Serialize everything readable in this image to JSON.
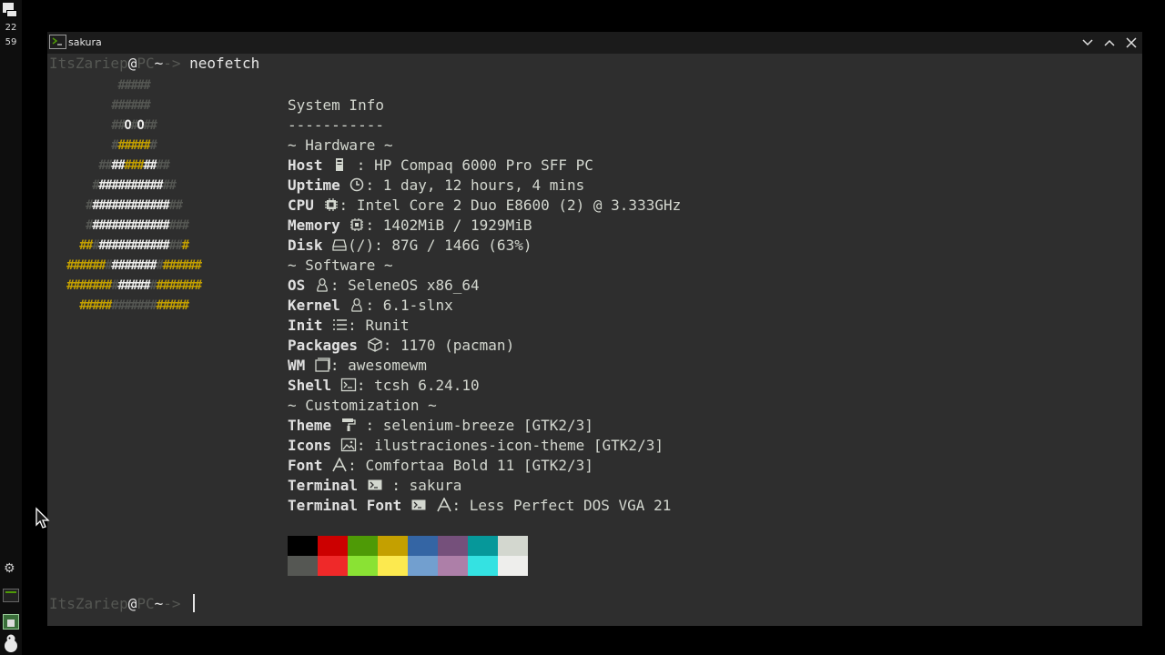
{
  "panel": {
    "clock_hour": "22",
    "clock_min": "59"
  },
  "window": {
    "title": "sakura"
  },
  "prompt": {
    "user": "ItsZariep",
    "at": "@",
    "host": "PC",
    "path": "~",
    "arrow": "->",
    "command": "neofetch"
  },
  "info": {
    "heading": "System Info",
    "rule": "-----------",
    "hardware_header": "~ Hardware ~",
    "software_header": "~ Software ~",
    "custom_header": "~ Customization ~",
    "rows": {
      "host": {
        "key": "Host",
        "value": " : HP Compaq 6000 Pro SFF PC"
      },
      "uptime": {
        "key": "Uptime",
        "value": ": 1 day, 12 hours, 4 mins"
      },
      "cpu": {
        "key": "CPU",
        "value": ": Intel Core 2 Duo E8600 (2) @ 3.333GHz"
      },
      "memory": {
        "key": "Memory",
        "value": ": 1402MiB / 1929MiB"
      },
      "disk": {
        "key": "Disk",
        "value": "(/): 87G / 146G (63%)"
      },
      "os": {
        "key": "OS",
        "value": ": SeleneOS x86_64"
      },
      "kernel": {
        "key": "Kernel",
        "value": ": 6.1-slnx"
      },
      "init": {
        "key": "Init",
        "value": ": Runit"
      },
      "packages": {
        "key": "Packages",
        "value": ": 1170 (pacman)"
      },
      "wm": {
        "key": "WM",
        "value": ": awesomewm"
      },
      "shell": {
        "key": "Shell",
        "value": ": tcsh 6.24.10"
      },
      "theme": {
        "key": "Theme",
        "value": " : selenium-breeze [GTK2/3]"
      },
      "icons": {
        "key": "Icons",
        "value": ": ilustraciones-icon-theme [GTK2/3]"
      },
      "font": {
        "key": "Font",
        "value": ": Comfortaa Bold 11 [GTK2/3]"
      },
      "terminal": {
        "key": "Terminal",
        "value": " : sakura"
      },
      "terminal_font": {
        "key": "Terminal Font",
        "value": ": Less Perfect DOS VGA 21"
      }
    }
  },
  "palette": {
    "normal": [
      "#000000",
      "#cc0000",
      "#4e9a06",
      "#c4a000",
      "#3465a4",
      "#75507b",
      "#06989a",
      "#d3d7cf"
    ],
    "bright": [
      "#555753",
      "#ef2929",
      "#8ae234",
      "#fce94f",
      "#729fcf",
      "#ad7fa8",
      "#34e2e2",
      "#eeeeec"
    ]
  },
  "icons": [
    "terminal-icon",
    "gear-icon",
    "home-icon",
    "penguin-icon",
    "minimize-icon",
    "maximize-icon",
    "close-icon",
    "mouse-pointer-icon"
  ]
}
